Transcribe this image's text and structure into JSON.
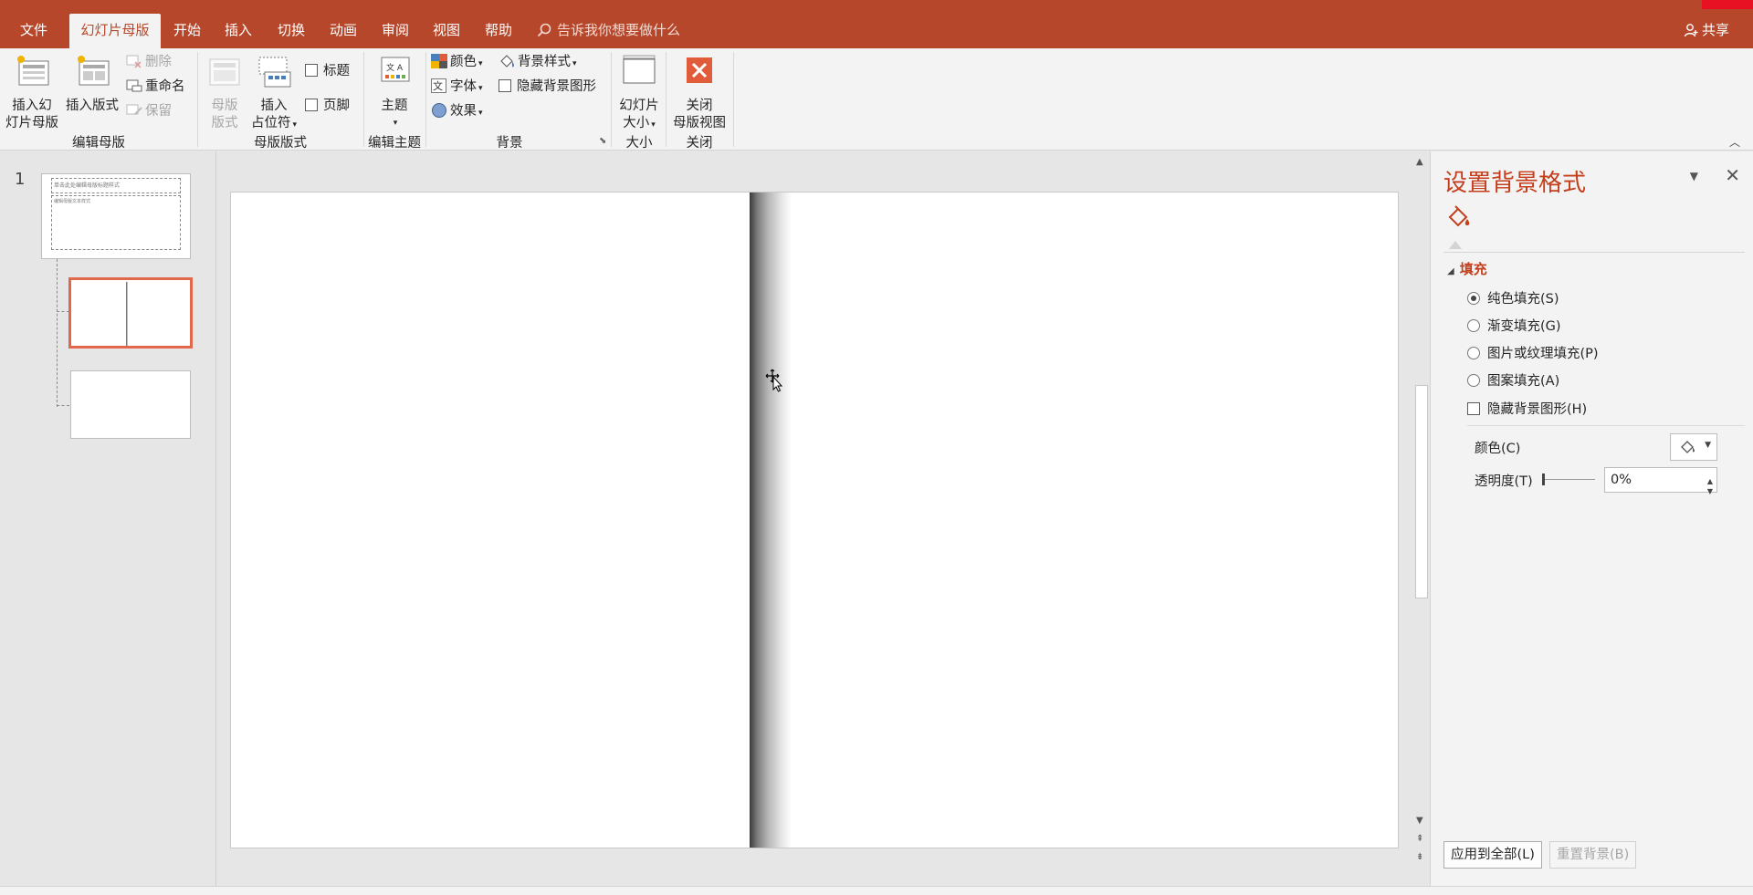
{
  "tabs": {
    "file": "文件",
    "slide_master": "幻灯片母版",
    "home": "开始",
    "insert": "插入",
    "transitions": "切换",
    "animations": "动画",
    "review": "审阅",
    "view": "视图",
    "help": "帮助"
  },
  "tell_me": "告诉我你想要做什么",
  "share": "共享",
  "ribbon": {
    "edit_master": {
      "insert_slide_master": [
        "插入幻",
        "灯片母版"
      ],
      "insert_layout": "插入版式",
      "delete": "删除",
      "rename": "重命名",
      "preserve": "保留",
      "label": "编辑母版"
    },
    "master_layout": {
      "master_layout": [
        "母版",
        "版式"
      ],
      "insert_placeholder": [
        "插入",
        "占位符"
      ],
      "title_checkbox": "标题",
      "footer_checkbox": "页脚",
      "label": "母版版式"
    },
    "edit_theme": {
      "themes": "主题",
      "label": "编辑主题"
    },
    "background": {
      "colors": "颜色",
      "fonts": "字体",
      "effects": "效果",
      "background_styles": "背景样式",
      "hide_background_graphics": "隐藏背景图形",
      "label": "背景"
    },
    "size": {
      "slide_size": [
        "幻灯片",
        "大小"
      ],
      "label": "大小"
    },
    "close": {
      "close_master_view": [
        "关闭",
        "母版视图"
      ],
      "label": "关闭"
    }
  },
  "thumbnails": {
    "slide_number": "1",
    "master_title_text": "单击此处编辑母版标题样式",
    "master_body_text": "编辑母版文本样式"
  },
  "format_pane": {
    "title": "设置背景格式",
    "section": "填充",
    "options": [
      {
        "label": "纯色填充(S)",
        "checked": true
      },
      {
        "label": "渐变填充(G)",
        "checked": false
      },
      {
        "label": "图片或纹理填充(P)",
        "checked": false
      },
      {
        "label": "图案填充(A)",
        "checked": false
      }
    ],
    "hide_bg_graphics": "隐藏背景图形(H)",
    "color_label": "颜色(C)",
    "transparency_label": "透明度(T)",
    "transparency_value": "0%",
    "transparency_level": 0,
    "apply_all": "应用到全部(L)",
    "reset_background": "重置背景(B)"
  },
  "colors": {
    "accent": "#b7472a",
    "pane_title": "#c43e1c",
    "selected_thumb": "#e1684a"
  }
}
